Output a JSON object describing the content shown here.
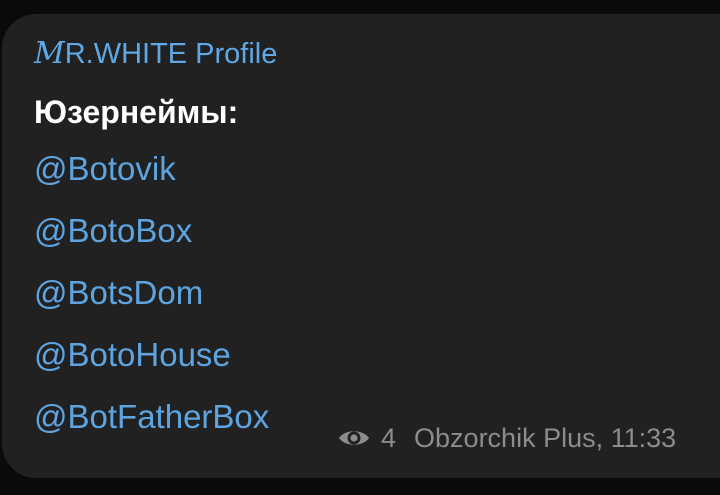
{
  "message": {
    "author": {
      "mr_m": "M",
      "mr_rest": "R.WHITE",
      "profile": "Profile"
    },
    "title": "Юзернеймы:",
    "links": [
      "@Botovik",
      "@BotoBox",
      "@BotsDom",
      "@BotoHouse",
      "@BotFatherBox"
    ],
    "meta": {
      "icon": "eye-icon",
      "views": "4",
      "channel_time": "Obzorchik Plus, 11:33"
    },
    "colors": {
      "bubble": "#212121",
      "link": "#5ea4e0",
      "title": "#ffffff",
      "meta": "#8c8c8c",
      "background": "#0a0a0a"
    }
  }
}
